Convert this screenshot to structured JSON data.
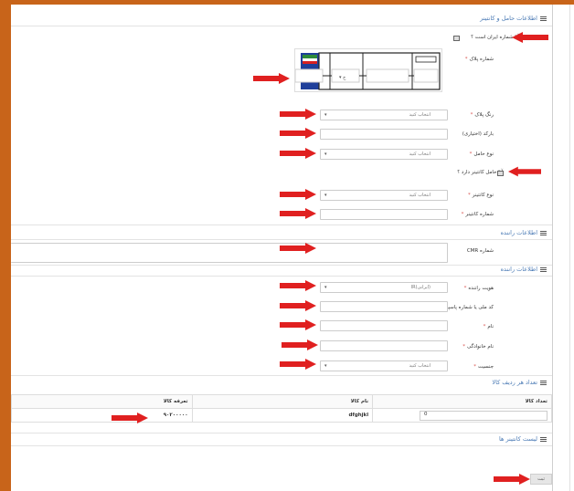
{
  "sections": {
    "vehicle": "اطلاعات حامل و کانتینر",
    "driver1": "اطلاعات راننده",
    "driver2": "اطلاعات راننده",
    "goods_count": "تعداد هر ردیف کالا",
    "containers_list": "لیست کانتینر ها"
  },
  "vehicle": {
    "iran_plate_question": "آیا شماره ایران است ؟",
    "plate_number_label": "شماره پلاک",
    "plate_color_label": "رنگ پلاک",
    "plate_color_value": "انتخاب کنید",
    "barcode_label": "بارکد (اختیاری)",
    "carrier_type_label": "نوع حامل",
    "carrier_type_value": "انتخاب کنید",
    "has_container_question": "آیا حامل کانتینر دارد ؟",
    "container_type_label": "نوع کانتینر",
    "container_type_value": "انتخاب کنید",
    "container_number_label": "شماره کانتینر"
  },
  "driver_cmr": {
    "cmr_label": "شماره CMR"
  },
  "driver": {
    "identity_label": "هویت راننده",
    "identity_value": "(ایرانی)IR",
    "national_code_label": "کد ملی یا شماره پاسپورت",
    "first_name_label": "نام",
    "last_name_label": "نام خانوادگی",
    "gender_label": "جنسیت",
    "gender_value": "انتخاب کنید"
  },
  "required_mark": "*",
  "goods_table": {
    "headers": [
      "تعرفه کالا",
      "نام کالا",
      "تعداد کالا"
    ],
    "rows": [
      [
        "۹۰۲۰۰۰۰۰",
        "dfghjkl",
        "0"
      ]
    ]
  },
  "submit_label": "ثبت",
  "colors": {
    "frame": "#c8641a",
    "arrow": "#e02020",
    "section_title": "#4a7ab5"
  },
  "icons": [
    "menu-bars-icon",
    "checkbox-icon",
    "dropdown-caret-icon",
    "red-arrow-icon",
    "plate-flag-icon"
  ]
}
